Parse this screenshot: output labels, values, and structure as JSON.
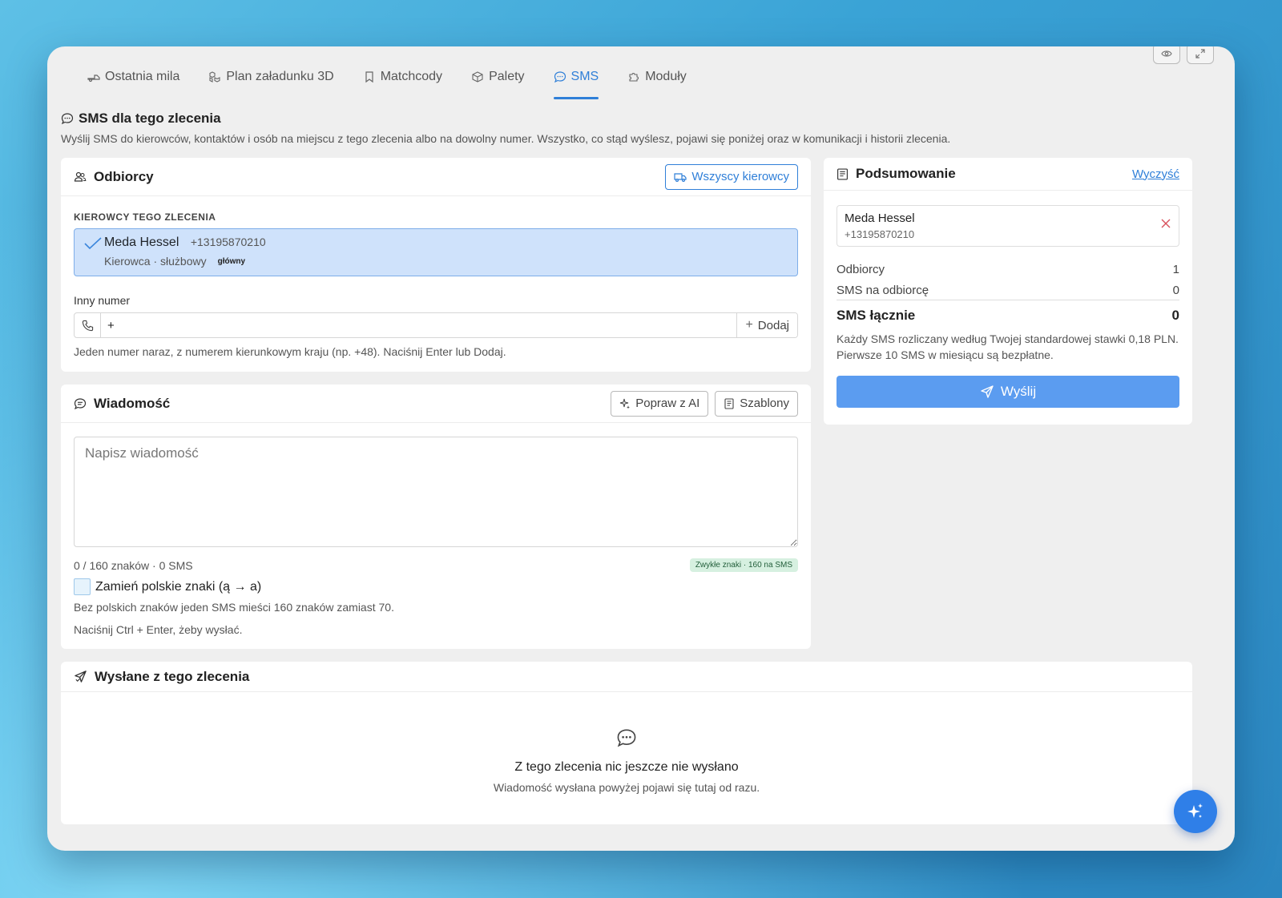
{
  "tabs": [
    {
      "label": "Ostatnia mila",
      "icon": "delivery-icon"
    },
    {
      "label": "Plan załadunku 3D",
      "icon": "boxes-icon"
    },
    {
      "label": "Matchcody",
      "icon": "bookmark-icon"
    },
    {
      "label": "Palety",
      "icon": "package-icon"
    },
    {
      "label": "SMS",
      "icon": "chat-icon",
      "active": true
    },
    {
      "label": "Moduły",
      "icon": "puzzle-icon"
    }
  ],
  "page": {
    "title": "SMS dla tego zlecenia",
    "description": "Wyślij SMS do kierowców, kontaktów i osób na miejscu z tego zlecenia albo na dowolny numer. Wszystko, co stąd wyślesz, pojawi się poniżej oraz w komunikacji i historii zlecenia."
  },
  "recipients": {
    "title": "Odbiorcy",
    "all_drivers_label": "Wszyscy kierowcy",
    "section_label": "KIEROWCY TEGO ZLECENIA",
    "driver": {
      "name": "Meda Hessel",
      "phone": "+13195870210",
      "role": "Kierowca · służbowy",
      "badge": "główny",
      "selected": true
    },
    "other_number_label": "Inny numer",
    "other_number_value": "+",
    "add_label": "Dodaj",
    "hint": "Jeden numer naraz, z numerem kierunkowym kraju (np. +48). Naciśnij Enter lub Dodaj."
  },
  "message": {
    "title": "Wiadomość",
    "ai_label": "Popraw z AI",
    "templates_label": "Szablony",
    "placeholder": "Napisz wiadomość",
    "counter": "0 / 160 znaków · 0 SMS",
    "encoding_badge": "Zwykłe znaki · 160 na SMS",
    "replace_label": "Zamień polskie znaki (ą → a)",
    "replace_hint": "Bez polskich znaków jeden SMS mieści 160 znaków zamiast 70.",
    "shortcut_hint": "Naciśnij Ctrl + Enter, żeby wysłać."
  },
  "summary": {
    "title": "Podsumowanie",
    "clear_label": "Wyczyść",
    "recipient_name": "Meda Hessel",
    "recipient_phone": "+13195870210",
    "recipients_label": "Odbiorcy",
    "recipients_value": "1",
    "per_recipient_label": "SMS na odbiorcę",
    "per_recipient_value": "0",
    "total_label": "SMS łącznie",
    "total_value": "0",
    "note": "Każdy SMS rozliczany według Twojej standardowej stawki 0,18 PLN. Pierwsze 10 SMS w miesiącu są bezpłatne.",
    "send_label": "Wyślij"
  },
  "sent": {
    "title": "Wysłane z tego zlecenia",
    "empty_title": "Z tego zlecenia nic jeszcze nie wysłano",
    "empty_sub": "Wiadomość wysłana powyżej pojawi się tutaj od razu."
  },
  "colors": {
    "accent": "#2f7fd8",
    "send_button": "#5b9cf0",
    "selected_bg": "#cfe2fb"
  }
}
